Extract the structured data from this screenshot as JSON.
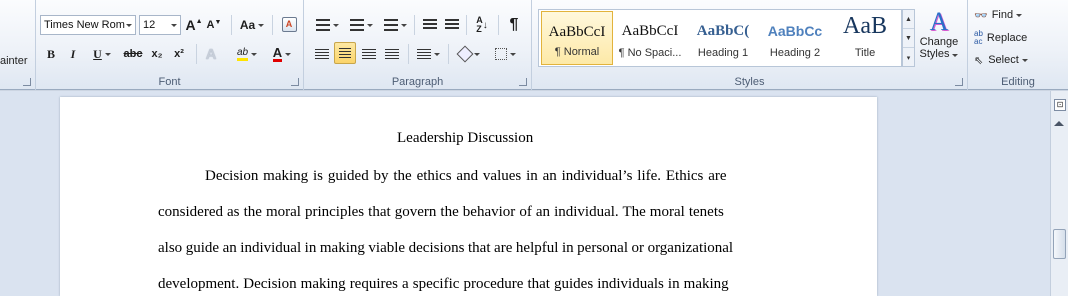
{
  "ribbon": {
    "clipboard": {
      "painter_label": "ainter"
    },
    "font": {
      "group_label": "Font",
      "font_name": "Times New Rom",
      "font_size": "12",
      "bold": "B",
      "italic": "I",
      "underline": "U",
      "strikethrough": "abc",
      "subscript": "x₂",
      "superscript": "x²",
      "grow": "A",
      "shrink": "A",
      "change_case": "Aa",
      "highlight": "ab",
      "font_color": "A",
      "clear": "A"
    },
    "paragraph": {
      "group_label": "Paragraph",
      "pilcrow": "¶"
    },
    "styles": {
      "group_label": "Styles",
      "tiles": [
        {
          "sample": "AaBbCcI",
          "name": "¶ Normal",
          "color": "#111111"
        },
        {
          "sample": "AaBbCcI",
          "name": "¶ No Spaci...",
          "color": "#111111"
        },
        {
          "sample": "AaBbC(",
          "name": "Heading 1",
          "color": "#365f91"
        },
        {
          "sample": "AaBbCc",
          "name": "Heading 2",
          "color": "#4f81bd"
        },
        {
          "sample": "AaB",
          "name": "Title",
          "color": "#17365d"
        }
      ],
      "change_styles": "Change",
      "change_styles_2": "Styles"
    },
    "editing": {
      "group_label": "Editing",
      "find": "Find",
      "replace": "Replace",
      "select": "Select"
    }
  },
  "document": {
    "title": "Leadership Discussion",
    "lines": [
      "Decision making is guided by the ethics and values in an individual’s life. Ethics are",
      "considered as the moral principles that govern the behavior of an individual. The moral tenets",
      "also guide an individual in making viable decisions that are helpful in personal or organizational",
      "development. Decision making requires a specific procedure that guides individuals in making"
    ]
  }
}
